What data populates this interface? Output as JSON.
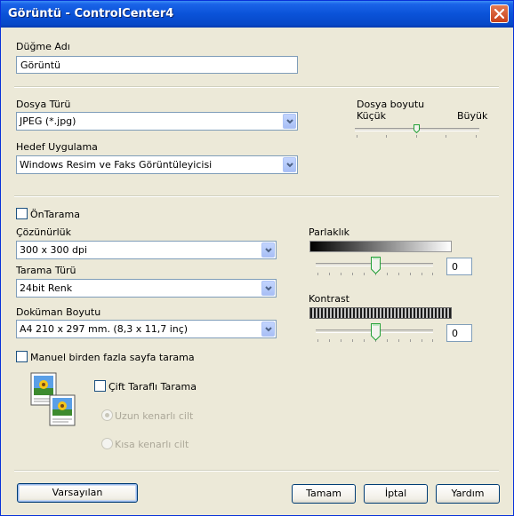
{
  "window": {
    "title": "Görüntü - ControlCenter4"
  },
  "button_name": {
    "label": "Düğme Adı",
    "value": "Görüntü"
  },
  "file_type": {
    "label": "Dosya Türü",
    "value": "JPEG (*.jpg)"
  },
  "target_app": {
    "label": "Hedef Uygulama",
    "value": "Windows Resim ve Faks Görüntüleyicisi"
  },
  "file_size": {
    "label": "Dosya boyutu",
    "min_label": "Küçük",
    "max_label": "Büyük",
    "level": 0.55
  },
  "prescan": {
    "label": "ÖnTarama",
    "checked": false
  },
  "resolution": {
    "label": "Çözünürlük",
    "value": "300 x 300 dpi"
  },
  "scan_type": {
    "label": "Tarama Türü",
    "value": "24bit Renk"
  },
  "document_size": {
    "label": "Doküman Boyutu",
    "value": "A4 210 x 297 mm. (8,3 x 11,7 inç)"
  },
  "brightness": {
    "label": "Parlaklık",
    "value": "0",
    "level": 0.5
  },
  "contrast": {
    "label": "Kontrast",
    "value": "0",
    "level": 0.5
  },
  "multi_page": {
    "label": "Manuel birden fazla sayfa tarama",
    "checked": false
  },
  "duplex": {
    "label": "Çift Taraflı Tarama",
    "checked": false,
    "long_edge": "Uzun kenarlı cilt",
    "short_edge": "Kısa kenarlı cilt",
    "selected": "long_edge"
  },
  "buttons": {
    "defaults": "Varsayılan",
    "ok": "Tamam",
    "cancel": "İptal",
    "help": "Yardım"
  },
  "colors": {
    "title_bar": "#0a52d8",
    "window_bg": "#ece9d8",
    "border": "#0831d9"
  }
}
